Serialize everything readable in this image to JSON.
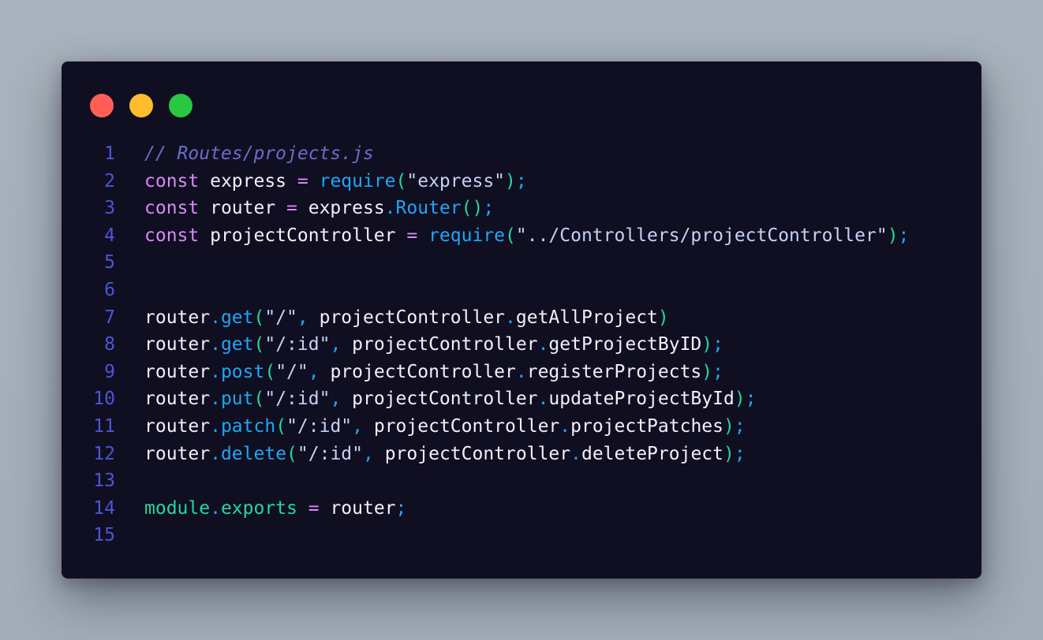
{
  "colors": {
    "background": "#a6b0bb",
    "window": "#100e21",
    "traffic_red": "#ff5f57",
    "traffic_yellow": "#febc2e",
    "traffic_green": "#28c840",
    "line_number": "#4b56d8",
    "comment": "#6a6ec9",
    "keyword": "#d78af5",
    "plain": "#f1f1f7",
    "operator": "#d78af5",
    "function": "#1ea7f5",
    "paren": "#22d8a0",
    "string": "#c4d2f4",
    "string_quote": "#c4d2f4",
    "punct": "#1ea7f5",
    "builtin": "#22d8a0"
  },
  "window_controls": [
    {
      "name": "close-dot",
      "color": "#ff5f57"
    },
    {
      "name": "minimize-dot",
      "color": "#febc2e"
    },
    {
      "name": "maximize-dot",
      "color": "#28c840"
    }
  ],
  "code_lines": [
    {
      "n": "1",
      "tokens": [
        {
          "t": "// Routes/projects.js",
          "k": "comment"
        }
      ]
    },
    {
      "n": "2",
      "tokens": [
        {
          "t": "const",
          "k": "keyword"
        },
        {
          "t": " express ",
          "k": "plain"
        },
        {
          "t": "=",
          "k": "operator"
        },
        {
          "t": " ",
          "k": "plain"
        },
        {
          "t": "require",
          "k": "function"
        },
        {
          "t": "(",
          "k": "paren"
        },
        {
          "t": "\"express\"",
          "k": "string"
        },
        {
          "t": ")",
          "k": "paren"
        },
        {
          "t": ";",
          "k": "punct"
        }
      ]
    },
    {
      "n": "3",
      "tokens": [
        {
          "t": "const",
          "k": "keyword"
        },
        {
          "t": " router ",
          "k": "plain"
        },
        {
          "t": "=",
          "k": "operator"
        },
        {
          "t": " express",
          "k": "plain"
        },
        {
          "t": ".",
          "k": "punct"
        },
        {
          "t": "Router",
          "k": "function"
        },
        {
          "t": "()",
          "k": "paren"
        },
        {
          "t": ";",
          "k": "punct"
        }
      ]
    },
    {
      "n": "4",
      "tokens": [
        {
          "t": "const",
          "k": "keyword"
        },
        {
          "t": " projectController ",
          "k": "plain"
        },
        {
          "t": "=",
          "k": "operator"
        },
        {
          "t": " ",
          "k": "plain"
        },
        {
          "t": "require",
          "k": "function"
        },
        {
          "t": "(",
          "k": "paren"
        },
        {
          "t": "\"../Controllers/projectController\"",
          "k": "string"
        },
        {
          "t": ")",
          "k": "paren"
        },
        {
          "t": ";",
          "k": "punct"
        }
      ]
    },
    {
      "n": "5",
      "tokens": []
    },
    {
      "n": "6",
      "tokens": []
    },
    {
      "n": "7",
      "tokens": [
        {
          "t": "router",
          "k": "plain"
        },
        {
          "t": ".",
          "k": "punct"
        },
        {
          "t": "get",
          "k": "function"
        },
        {
          "t": "(",
          "k": "paren"
        },
        {
          "t": "\"/\"",
          "k": "string"
        },
        {
          "t": ",",
          "k": "punct"
        },
        {
          "t": " projectController",
          "k": "plain"
        },
        {
          "t": ".",
          "k": "punct"
        },
        {
          "t": "getAllProject",
          "k": "plain"
        },
        {
          "t": ")",
          "k": "paren"
        }
      ]
    },
    {
      "n": "8",
      "tokens": [
        {
          "t": "router",
          "k": "plain"
        },
        {
          "t": ".",
          "k": "punct"
        },
        {
          "t": "get",
          "k": "function"
        },
        {
          "t": "(",
          "k": "paren"
        },
        {
          "t": "\"/:id\"",
          "k": "string"
        },
        {
          "t": ",",
          "k": "punct"
        },
        {
          "t": " projectController",
          "k": "plain"
        },
        {
          "t": ".",
          "k": "punct"
        },
        {
          "t": "getProjectByID",
          "k": "plain"
        },
        {
          "t": ")",
          "k": "paren"
        },
        {
          "t": ";",
          "k": "punct"
        }
      ]
    },
    {
      "n": "9",
      "tokens": [
        {
          "t": "router",
          "k": "plain"
        },
        {
          "t": ".",
          "k": "punct"
        },
        {
          "t": "post",
          "k": "function"
        },
        {
          "t": "(",
          "k": "paren"
        },
        {
          "t": "\"/\"",
          "k": "string"
        },
        {
          "t": ",",
          "k": "punct"
        },
        {
          "t": " projectController",
          "k": "plain"
        },
        {
          "t": ".",
          "k": "punct"
        },
        {
          "t": "registerProjects",
          "k": "plain"
        },
        {
          "t": ")",
          "k": "paren"
        },
        {
          "t": ";",
          "k": "punct"
        }
      ]
    },
    {
      "n": "10",
      "tokens": [
        {
          "t": "router",
          "k": "plain"
        },
        {
          "t": ".",
          "k": "punct"
        },
        {
          "t": "put",
          "k": "function"
        },
        {
          "t": "(",
          "k": "paren"
        },
        {
          "t": "\"/:id\"",
          "k": "string"
        },
        {
          "t": ",",
          "k": "punct"
        },
        {
          "t": " projectController",
          "k": "plain"
        },
        {
          "t": ".",
          "k": "punct"
        },
        {
          "t": "updateProjectById",
          "k": "plain"
        },
        {
          "t": ")",
          "k": "paren"
        },
        {
          "t": ";",
          "k": "punct"
        }
      ]
    },
    {
      "n": "11",
      "tokens": [
        {
          "t": "router",
          "k": "plain"
        },
        {
          "t": ".",
          "k": "punct"
        },
        {
          "t": "patch",
          "k": "function"
        },
        {
          "t": "(",
          "k": "paren"
        },
        {
          "t": "\"/:id\"",
          "k": "string"
        },
        {
          "t": ",",
          "k": "punct"
        },
        {
          "t": " projectController",
          "k": "plain"
        },
        {
          "t": ".",
          "k": "punct"
        },
        {
          "t": "projectPatches",
          "k": "plain"
        },
        {
          "t": ")",
          "k": "paren"
        },
        {
          "t": ";",
          "k": "punct"
        }
      ]
    },
    {
      "n": "12",
      "tokens": [
        {
          "t": "router",
          "k": "plain"
        },
        {
          "t": ".",
          "k": "punct"
        },
        {
          "t": "delete",
          "k": "function"
        },
        {
          "t": "(",
          "k": "paren"
        },
        {
          "t": "\"/:id\"",
          "k": "string"
        },
        {
          "t": ",",
          "k": "punct"
        },
        {
          "t": " projectController",
          "k": "plain"
        },
        {
          "t": ".",
          "k": "punct"
        },
        {
          "t": "deleteProject",
          "k": "plain"
        },
        {
          "t": ")",
          "k": "paren"
        },
        {
          "t": ";",
          "k": "punct"
        }
      ]
    },
    {
      "n": "13",
      "tokens": []
    },
    {
      "n": "14",
      "tokens": [
        {
          "t": "module",
          "k": "builtin"
        },
        {
          "t": ".",
          "k": "punct"
        },
        {
          "t": "exports",
          "k": "builtin"
        },
        {
          "t": " ",
          "k": "plain"
        },
        {
          "t": "=",
          "k": "operator"
        },
        {
          "t": " router",
          "k": "plain"
        },
        {
          "t": ";",
          "k": "punct"
        }
      ]
    },
    {
      "n": "15",
      "tokens": []
    }
  ]
}
